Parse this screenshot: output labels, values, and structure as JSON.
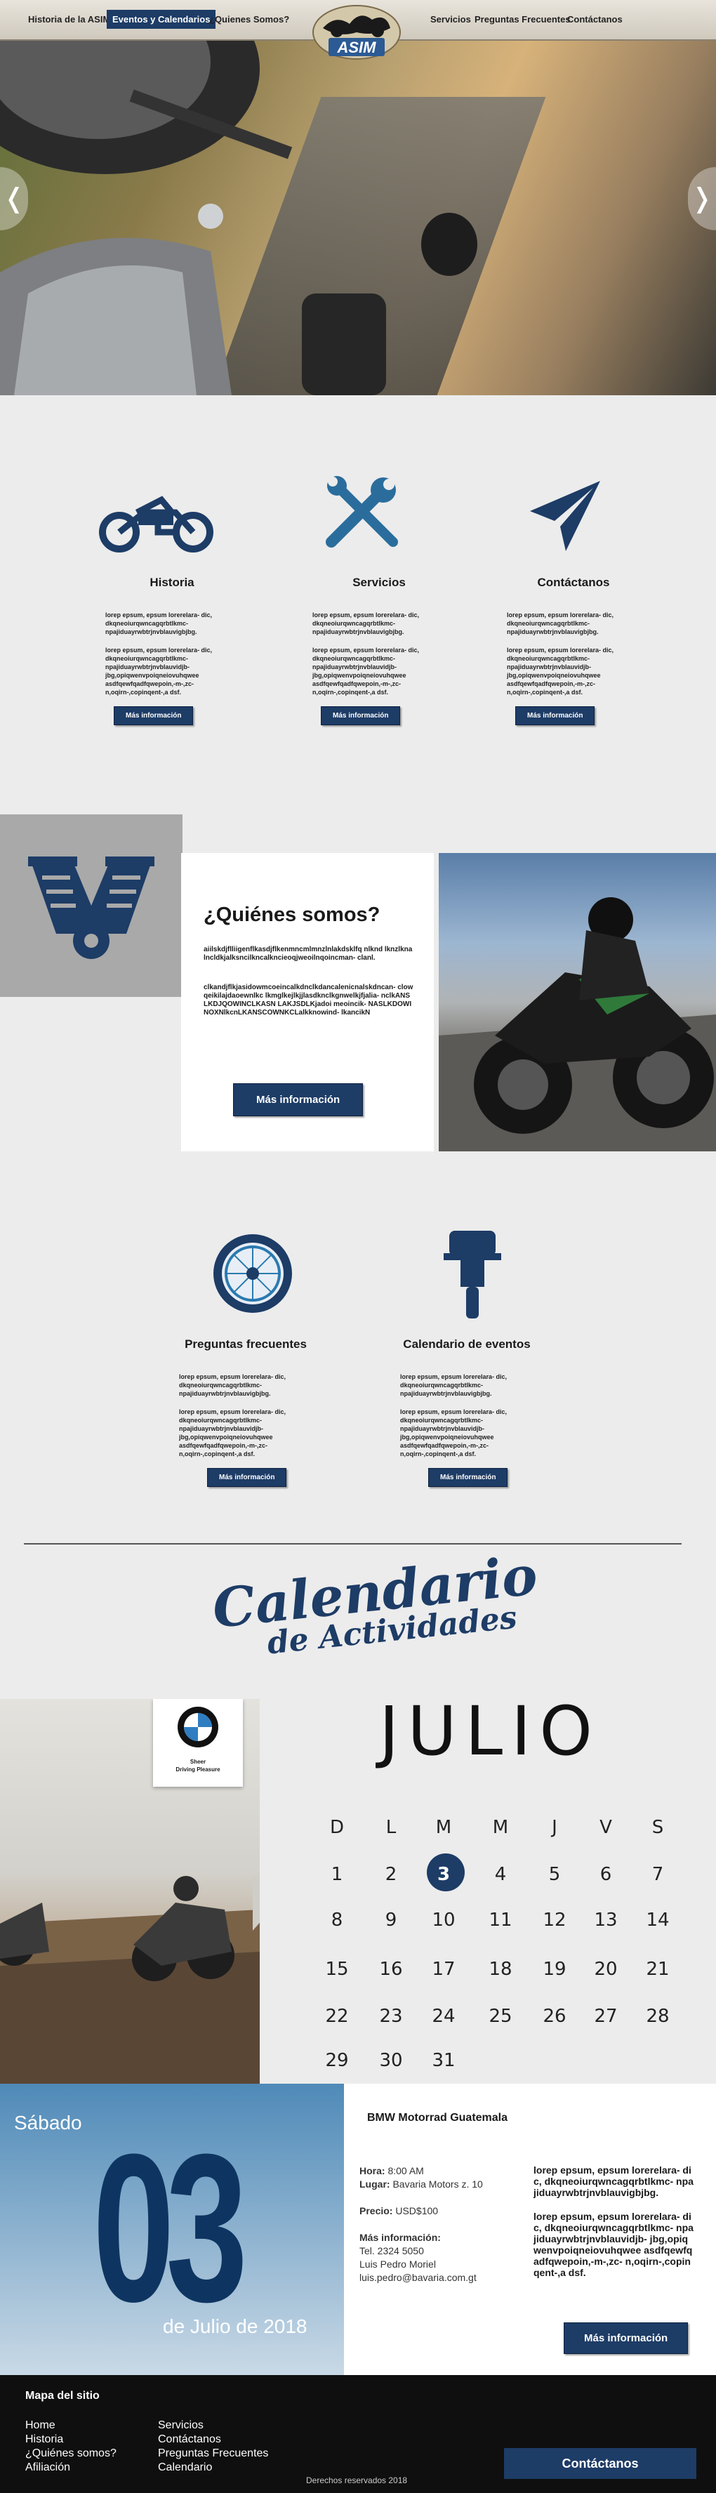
{
  "nav": {
    "items_left": [
      "Historia de la ASIM",
      "Eventos y Calendarios",
      "¿Quienes Somos?"
    ],
    "items_right": [
      "Servicios",
      "Preguntas Frecuentes",
      "Contáctanos"
    ],
    "logo_text": "ASIM"
  },
  "hero": {
    "prev": "❬",
    "next": "❬"
  },
  "features": [
    {
      "title": "Historia",
      "p1": "lorep epsum, epsum lorerelara- dic, dkqneoiurqwncagqrbtlkmc- npajiduayrwbtrjnvblauvigbjbg.",
      "p2": "lorep epsum, epsum lorerelara- dic, dkqneoiurqwncagqrbtlkmc- npajiduayrwbtrjnvblauvidjb- jbg,opiqwenvpoiqneiovuhqwee asdfqewfqadfqwepoin,-m-,zc- n,oqirn-,copinqent-,a dsf.",
      "btn": "Más información"
    },
    {
      "title": "Servicios",
      "p1": "lorep epsum, epsum lorerelara- dic, dkqneoiurqwncagqrbtlkmc- npajiduayrwbtrjnvblauvigbjbg.",
      "p2": "lorep epsum, epsum lorerelara- dic, dkqneoiurqwncagqrbtlkmc- npajiduayrwbtrjnvblauvidjb- jbg,opiqwenvpoiqneiovuhqwee asdfqewfqadfqwepoin,-m-,zc- n,oqirn-,copinqent-,a dsf.",
      "btn": "Más información"
    },
    {
      "title": "Contáctanos",
      "p1": "lorep epsum, epsum lorerelara- dic, dkqneoiurqwncagqrbtlkmc- npajiduayrwbtrjnvblauvigbjbg.",
      "p2": "lorep epsum, epsum lorerelara- dic, dkqneoiurqwncagqrbtlkmc- npajiduayrwbtrjnvblauvidjb- jbg,opiqwenvpoiqneiovuhqwee asdfqewfqadfqwepoin,-m-,zc- n,oqirn-,copinqent-,a dsf.",
      "btn": "Más información"
    }
  ],
  "about": {
    "title": "¿Quiénes somos?",
    "p1": "aiilskdjflliigenflkasdjflkenmncmlmnzlnlakdsklfq nlknd lknzlknalncldkjalksncilkncalkncieoqjweoilnqoincman- clanl.",
    "p2": "clkandjflkjasidowmcoeincalkdnclkdancalenicnalskdncan- clowqeikilajdaoewnlkc lkmglkejlkjjlasdknclkgnwelkjfjalia- nclkANSLKDJQOWINCLKASN LAKJSDLKjadoi meoincik- NASLKDOWINOXNlkcnLKANSCOWNKCLalkknowind- lkancikN",
    "btn": "Más información"
  },
  "faq": [
    {
      "title": "Preguntas frecuentes",
      "p1": "lorep epsum, epsum lorerelara- dic, dkqneoiurqwncagqrbtlkmc- npajiduayrwbtrjnvblauvigbjbg.",
      "p2": "lorep epsum, epsum lorerelara- dic, dkqneoiurqwncagqrbtlkmc- npajiduayrwbtrjnvblauvidjb- jbg,opiqwenvpoiqneiovuhqwee asdfqewfqadfqwepoin,-m-,zc- n,oqirn-,copinqent-,a dsf.",
      "btn": "Más información"
    },
    {
      "title": "Calendario de eventos",
      "p1": "lorep epsum, epsum lorerelara- dic, dkqneoiurqwncagqrbtlkmc- npajiduayrwbtrjnvblauvigbjbg.",
      "p2": "lorep epsum, epsum lorerelara- dic, dkqneoiurqwncagqrbtlkmc- npajiduayrwbtrjnvblauvidjb- jbg,opiqwenvpoiqneiovuhqwee asdfqewfqadfqwepoin,-m-,zc- n,oqirn-,copinqent-,a dsf.",
      "btn": "Más información"
    }
  ],
  "calendar": {
    "title_line1": "Calendario",
    "title_line2": "de Actividades",
    "bmw_slogan_1": "Sheer",
    "bmw_slogan_2": "Driving Pleasure",
    "month": "JULIO",
    "weekdays": [
      "D",
      "L",
      "M",
      "M",
      "J",
      "V",
      "S"
    ],
    "weeks": [
      [
        "1",
        "2",
        "3",
        "4",
        "5",
        "6",
        "7"
      ],
      [
        "8",
        "9",
        "10",
        "11",
        "12",
        "13",
        "14"
      ],
      [
        "15",
        "16",
        "17",
        "18",
        "19",
        "20",
        "21"
      ],
      [
        "22",
        "23",
        "24",
        "25",
        "26",
        "27",
        "28"
      ],
      [
        "29",
        "30",
        "31",
        "",
        "",
        "",
        ""
      ]
    ],
    "selected": "3"
  },
  "event": {
    "weekday": "Sábado",
    "day": "03",
    "date": "de Julio de 2018",
    "org": "BMW Motorrad Guatemala",
    "hora_label": "Hora:",
    "hora": "8:00 AM",
    "lugar_label": "Lugar:",
    "lugar": "Bavaria Motors z. 10",
    "precio_label": "Precio:",
    "precio": "USD$100",
    "info_label": "Más información:",
    "tel": "Tel. 2324 5050",
    "contact": "Luis Pedro Moriel",
    "email": "luis.pedro@bavaria.com.gt",
    "p1": "lorep epsum, epsum lorerelara- dic, dkqneoiurqwncagqrbtlkmc- npajiduayrwbtrjnvblauvigbjbg.",
    "p2": "lorep epsum, epsum lorerelara- dic, dkqneoiurqwncagqrbtlkmc- npajiduayrwbtrjnvblauvidjb- jbg,opiqwenvpoiqneiovuhqwee asdfqewfqadfqwepoin,-m-,zc- n,oqirn-,copinqent-,a dsf.",
    "btn": "Más información"
  },
  "footer": {
    "title": "Mapa del sitio",
    "col1": [
      "Home",
      "Historia",
      "¿Quiénes somos?",
      "Afiliación"
    ],
    "col2": [
      "Servicios",
      "Contáctanos",
      "Preguntas Frecuentes",
      "Calendario"
    ],
    "contact_btn": "Contáctanos",
    "rights": "Derechos reservados 2018"
  },
  "colors": {
    "brand": "#1d3c66",
    "dark": "#0f0f0f"
  }
}
